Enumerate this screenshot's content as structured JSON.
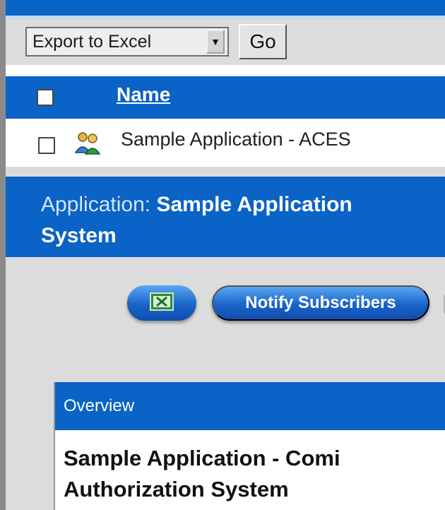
{
  "toolbar": {
    "export_select_value": "Export to Excel",
    "go_label": "Go"
  },
  "table": {
    "columns": [
      "Name"
    ],
    "rows": [
      {
        "name": "Sample Application - ACES",
        "icon": "application-users-icon"
      }
    ]
  },
  "application": {
    "prefix": "Application:",
    "name_line1": "Sample Application",
    "name_line2": "System"
  },
  "actions": {
    "excel_icon": "excel-icon",
    "notify_label": "Notify Subscribers"
  },
  "overview": {
    "label": "Overview",
    "title_line1": "Sample Application - Comi",
    "title_line2": "Authorization System"
  },
  "colors": {
    "brand_blue": "#0a63c6",
    "panel_grey": "#dcdcdc"
  }
}
